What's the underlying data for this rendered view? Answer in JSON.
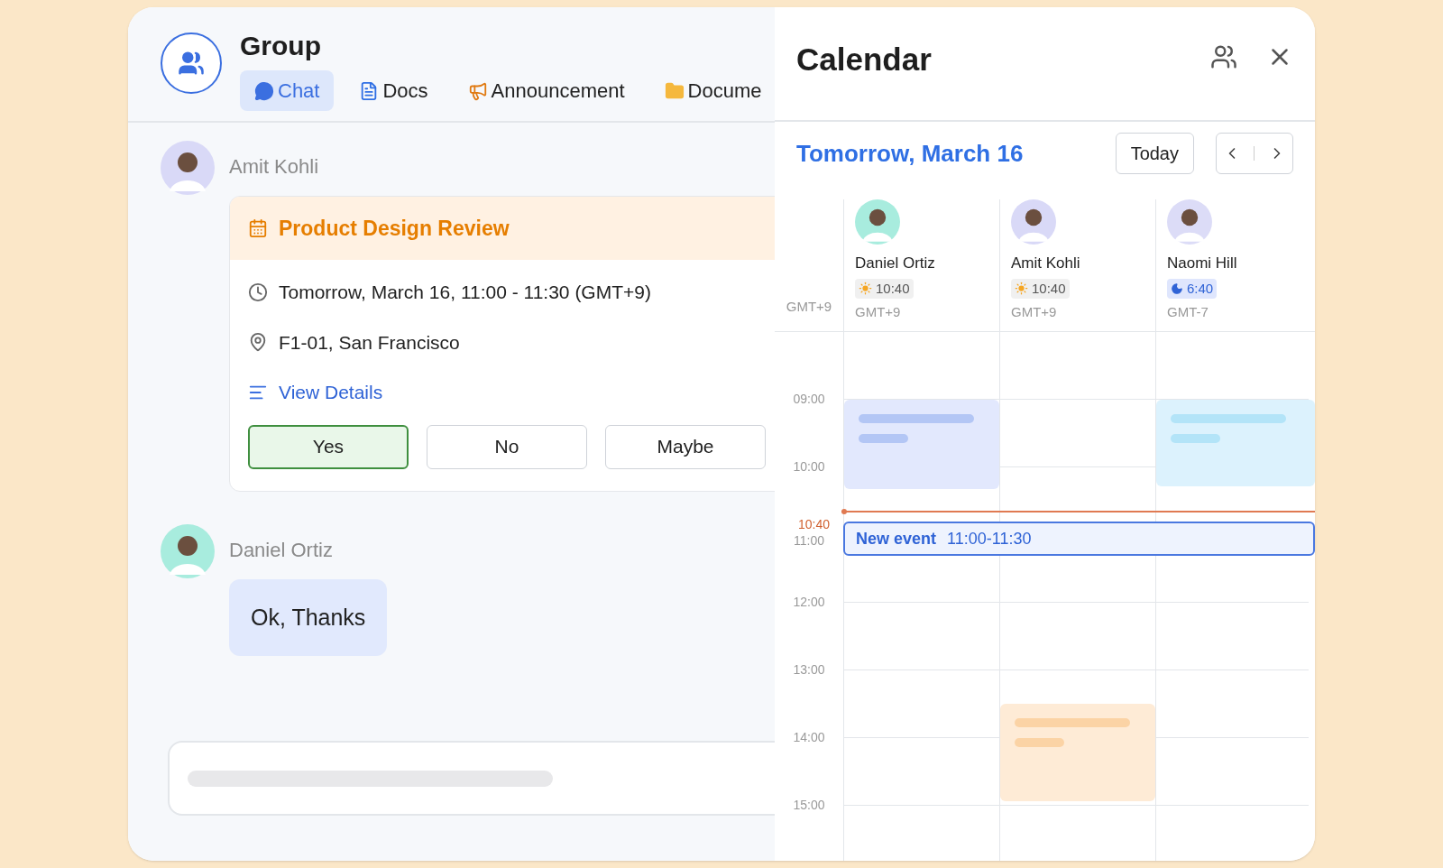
{
  "group": {
    "title": "Group"
  },
  "tabs": [
    {
      "label": "Chat",
      "kind": "chat",
      "selected": true
    },
    {
      "label": "Docs",
      "kind": "docs",
      "selected": false
    },
    {
      "label": "Announcement",
      "kind": "announcement",
      "selected": false
    },
    {
      "label": "Docume",
      "kind": "folder",
      "selected": false
    }
  ],
  "messages": [
    {
      "sender": "Amit Kohli",
      "color": "#d9d9f7",
      "kind": "event",
      "event": {
        "title": "Product Design Review",
        "time": "Tomorrow, March 16, 11:00 - 11:30 (GMT+9)",
        "location": "F1-01, San Francisco",
        "link": "View Details",
        "responses": [
          {
            "label": "Yes",
            "selected": true
          },
          {
            "label": "No",
            "selected": false
          },
          {
            "label": "Maybe",
            "selected": false
          }
        ]
      }
    },
    {
      "sender": "Daniel Ortiz",
      "color": "#a8ecde",
      "kind": "text",
      "text": "Ok, Thanks"
    }
  ],
  "calendar": {
    "title": "Calendar",
    "date": "Tomorrow, March 16",
    "today_button": "Today",
    "local_zone": "GMT+9",
    "people": [
      {
        "name": "Daniel Ortiz",
        "color": "#a8ecde",
        "time": "10:40",
        "kind": "day",
        "zone": "GMT+9"
      },
      {
        "name": "Amit Kohli",
        "color": "#d9d9f7",
        "time": "10:40",
        "kind": "day",
        "zone": "GMT+9"
      },
      {
        "name": "Naomi Hill",
        "color": "#dcdcf7",
        "time": "6:40",
        "kind": "night",
        "zone": "GMT-7"
      }
    ],
    "hours": [
      "09:00",
      "10:00",
      "11:00",
      "12:00",
      "13:00",
      "14:00",
      "15:00"
    ],
    "now_label": "10:40",
    "new_event": {
      "title": "New event",
      "time": "11:00-11:30"
    }
  }
}
